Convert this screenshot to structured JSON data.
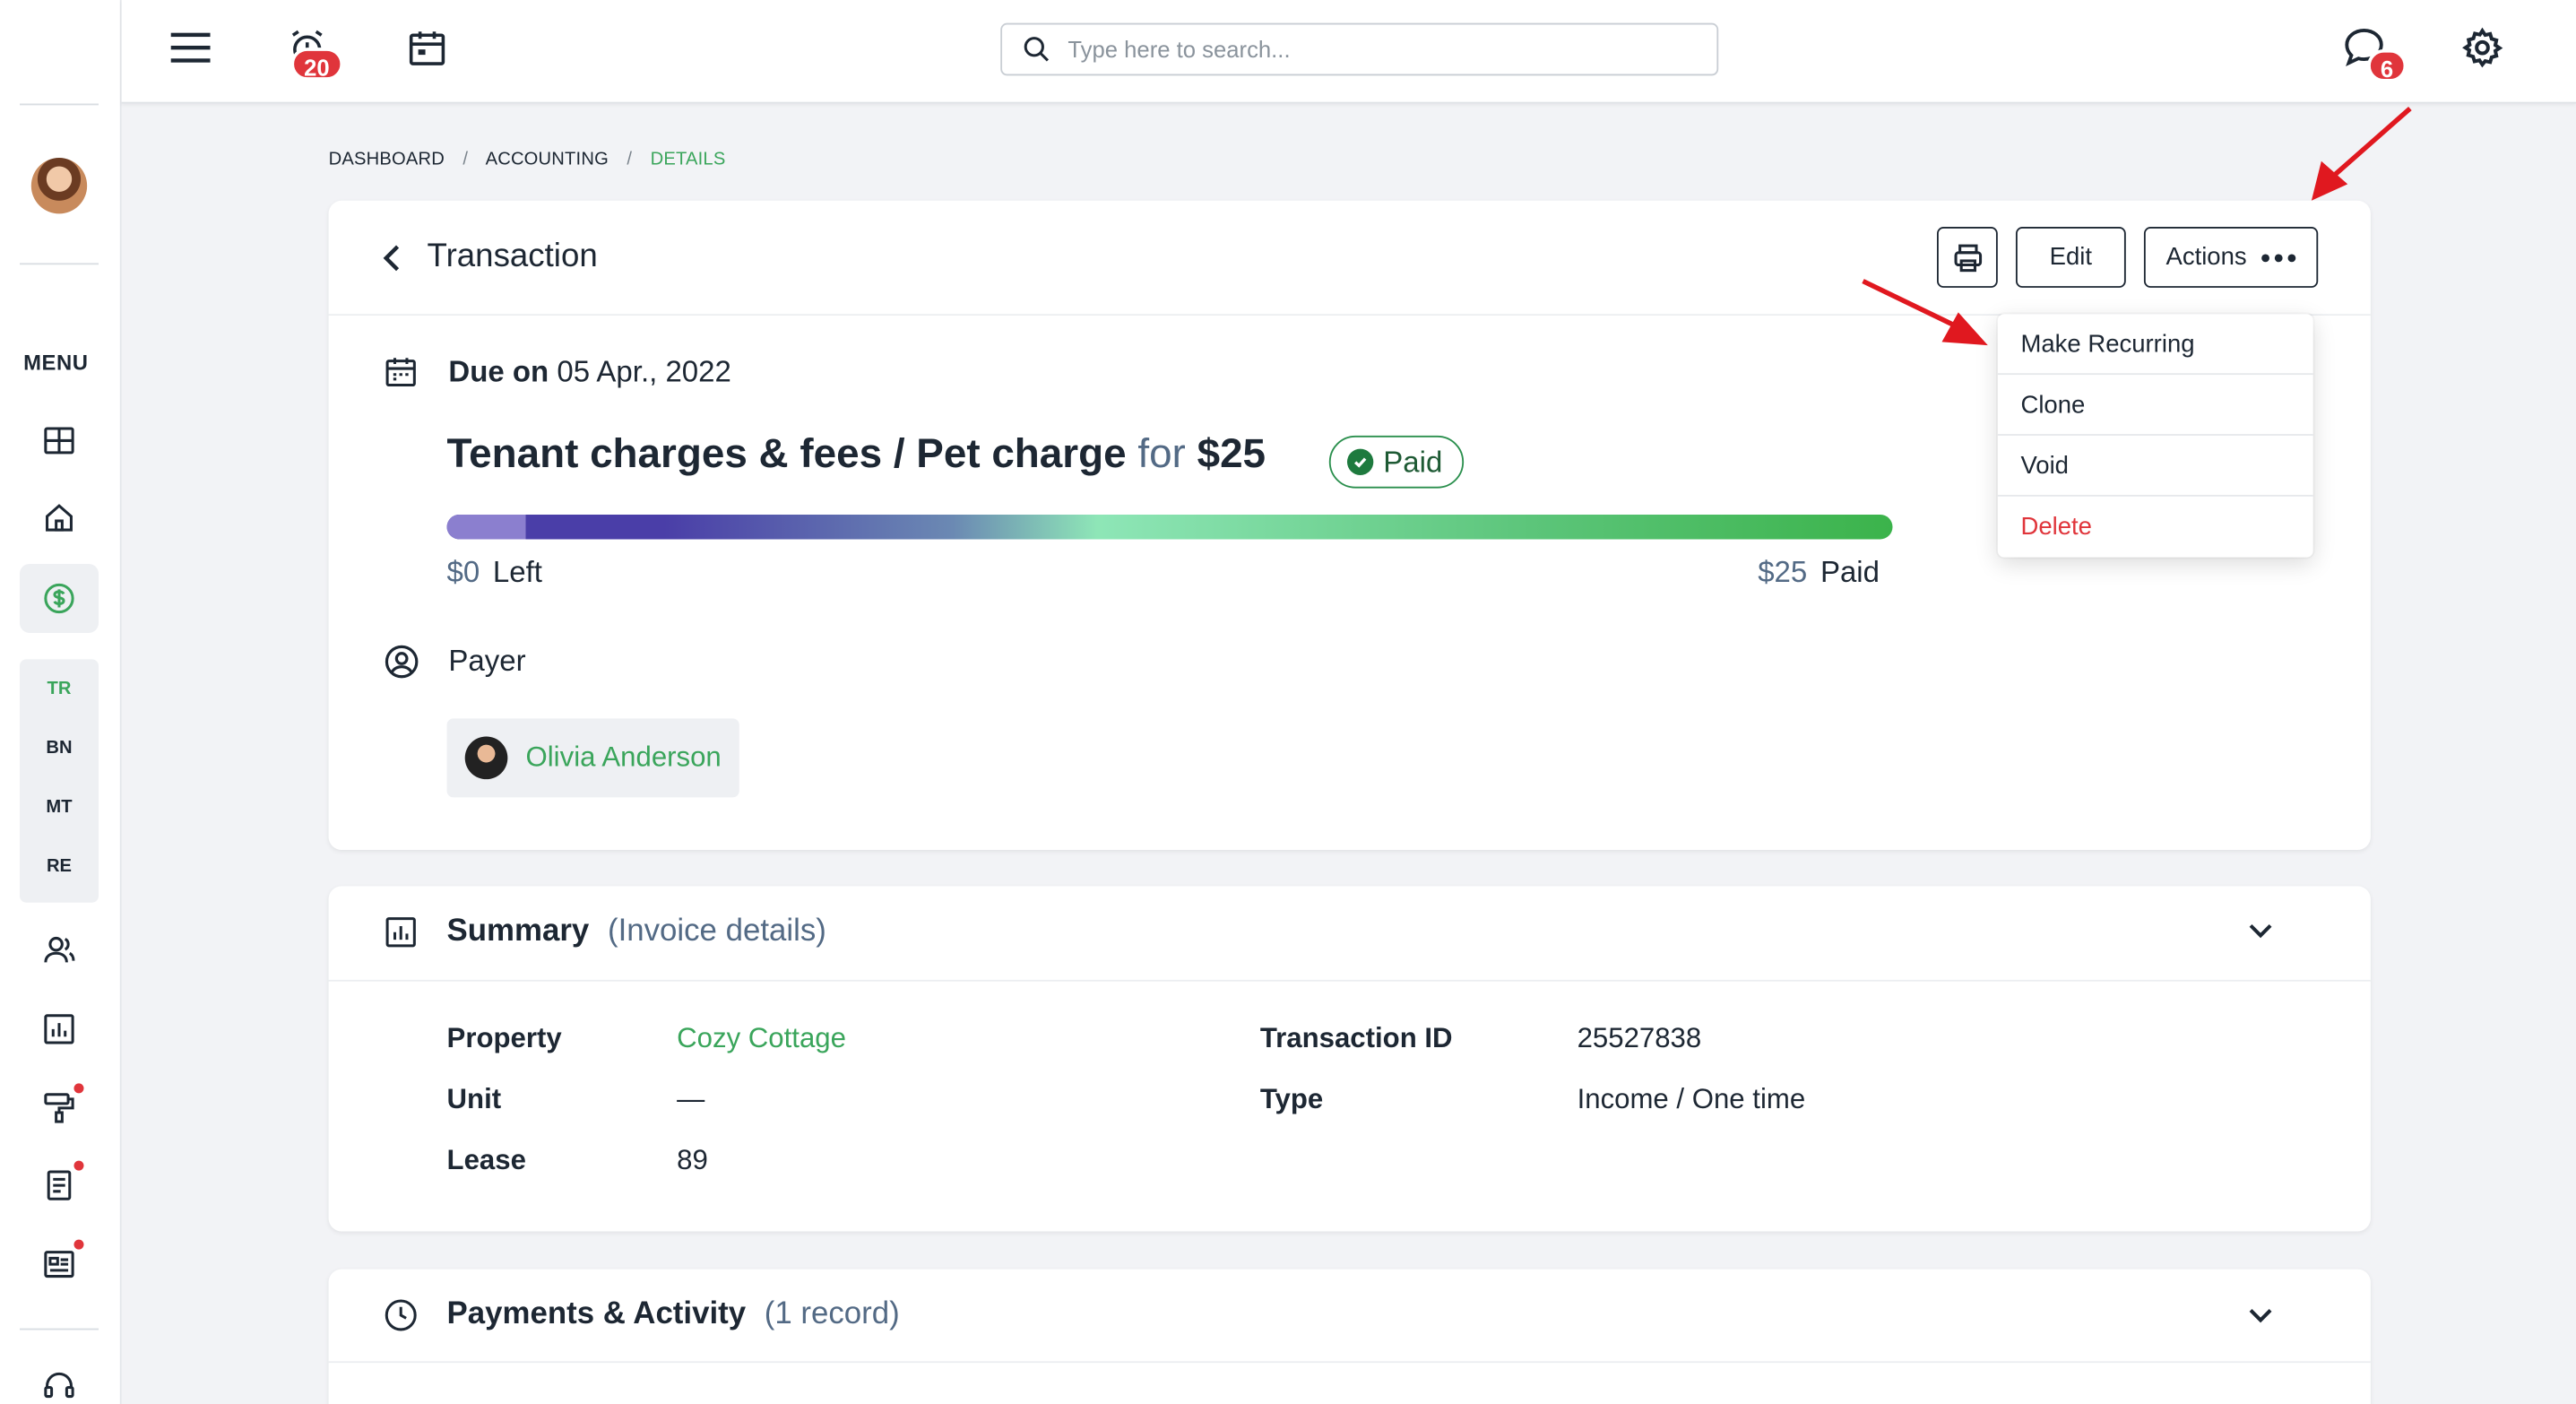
{
  "colors": {
    "accent_green": "#3aa55b",
    "danger_red": "#e0353b",
    "badge_red": "#e0353b",
    "text_dark": "#1d2733",
    "muted_blue": "#536a85"
  },
  "sidebar": {
    "menu_label": "MENU",
    "items": [
      {
        "name": "dashboard",
        "icon": "layout-icon"
      },
      {
        "name": "properties",
        "icon": "home-icon"
      },
      {
        "name": "accounting",
        "icon": "dollar-circle-icon",
        "active": true
      },
      {
        "name": "people",
        "icon": "people-icon"
      },
      {
        "name": "reports",
        "icon": "bar-chart-icon"
      },
      {
        "name": "maintenance",
        "icon": "paint-roller-icon",
        "has_notification": true
      },
      {
        "name": "documents",
        "icon": "document-icon",
        "has_notification": true
      },
      {
        "name": "communications",
        "icon": "newspaper-icon",
        "has_notification": true
      },
      {
        "name": "support",
        "icon": "headset-icon"
      }
    ],
    "subitems": [
      "TR",
      "BN",
      "MT",
      "RE"
    ],
    "active_subitem": "TR"
  },
  "topbar": {
    "alarm_badge": "20",
    "chat_badge": "6",
    "search_placeholder": "Type here to search..."
  },
  "breadcrumb": {
    "items": [
      "DASHBOARD",
      "ACCOUNTING",
      "DETAILS"
    ],
    "separator": "/"
  },
  "transaction": {
    "title": "Transaction",
    "edit_label": "Edit",
    "actions_label": "Actions",
    "due_label": "Due on",
    "due_date": "05 Apr., 2022",
    "headline": "Tenant charges & fees / Pet charge",
    "for_word": "for",
    "amount": "$25",
    "status": "Paid",
    "progress_paid_fraction": 1.0,
    "left_amount": "$0",
    "left_label": "Left",
    "paid_amount": "$25",
    "paid_label": "Paid",
    "payer_label": "Payer",
    "payer_name": "Olivia Anderson"
  },
  "actions_menu": {
    "items": [
      "Make Recurring",
      "Clone",
      "Void",
      "Delete"
    ]
  },
  "summary": {
    "title": "Summary",
    "subtitle": "(Invoice details)",
    "rows_left": [
      {
        "label": "Property",
        "value": "Cozy Cottage"
      },
      {
        "label": "Unit",
        "value": "—"
      },
      {
        "label": "Lease",
        "value": "89"
      }
    ],
    "rows_right": [
      {
        "label": "Transaction ID",
        "value": "25527838"
      },
      {
        "label": "Type",
        "value": "Income / One time"
      }
    ]
  },
  "payments": {
    "title": "Payments & Activity",
    "subtitle": "(1 record)"
  }
}
